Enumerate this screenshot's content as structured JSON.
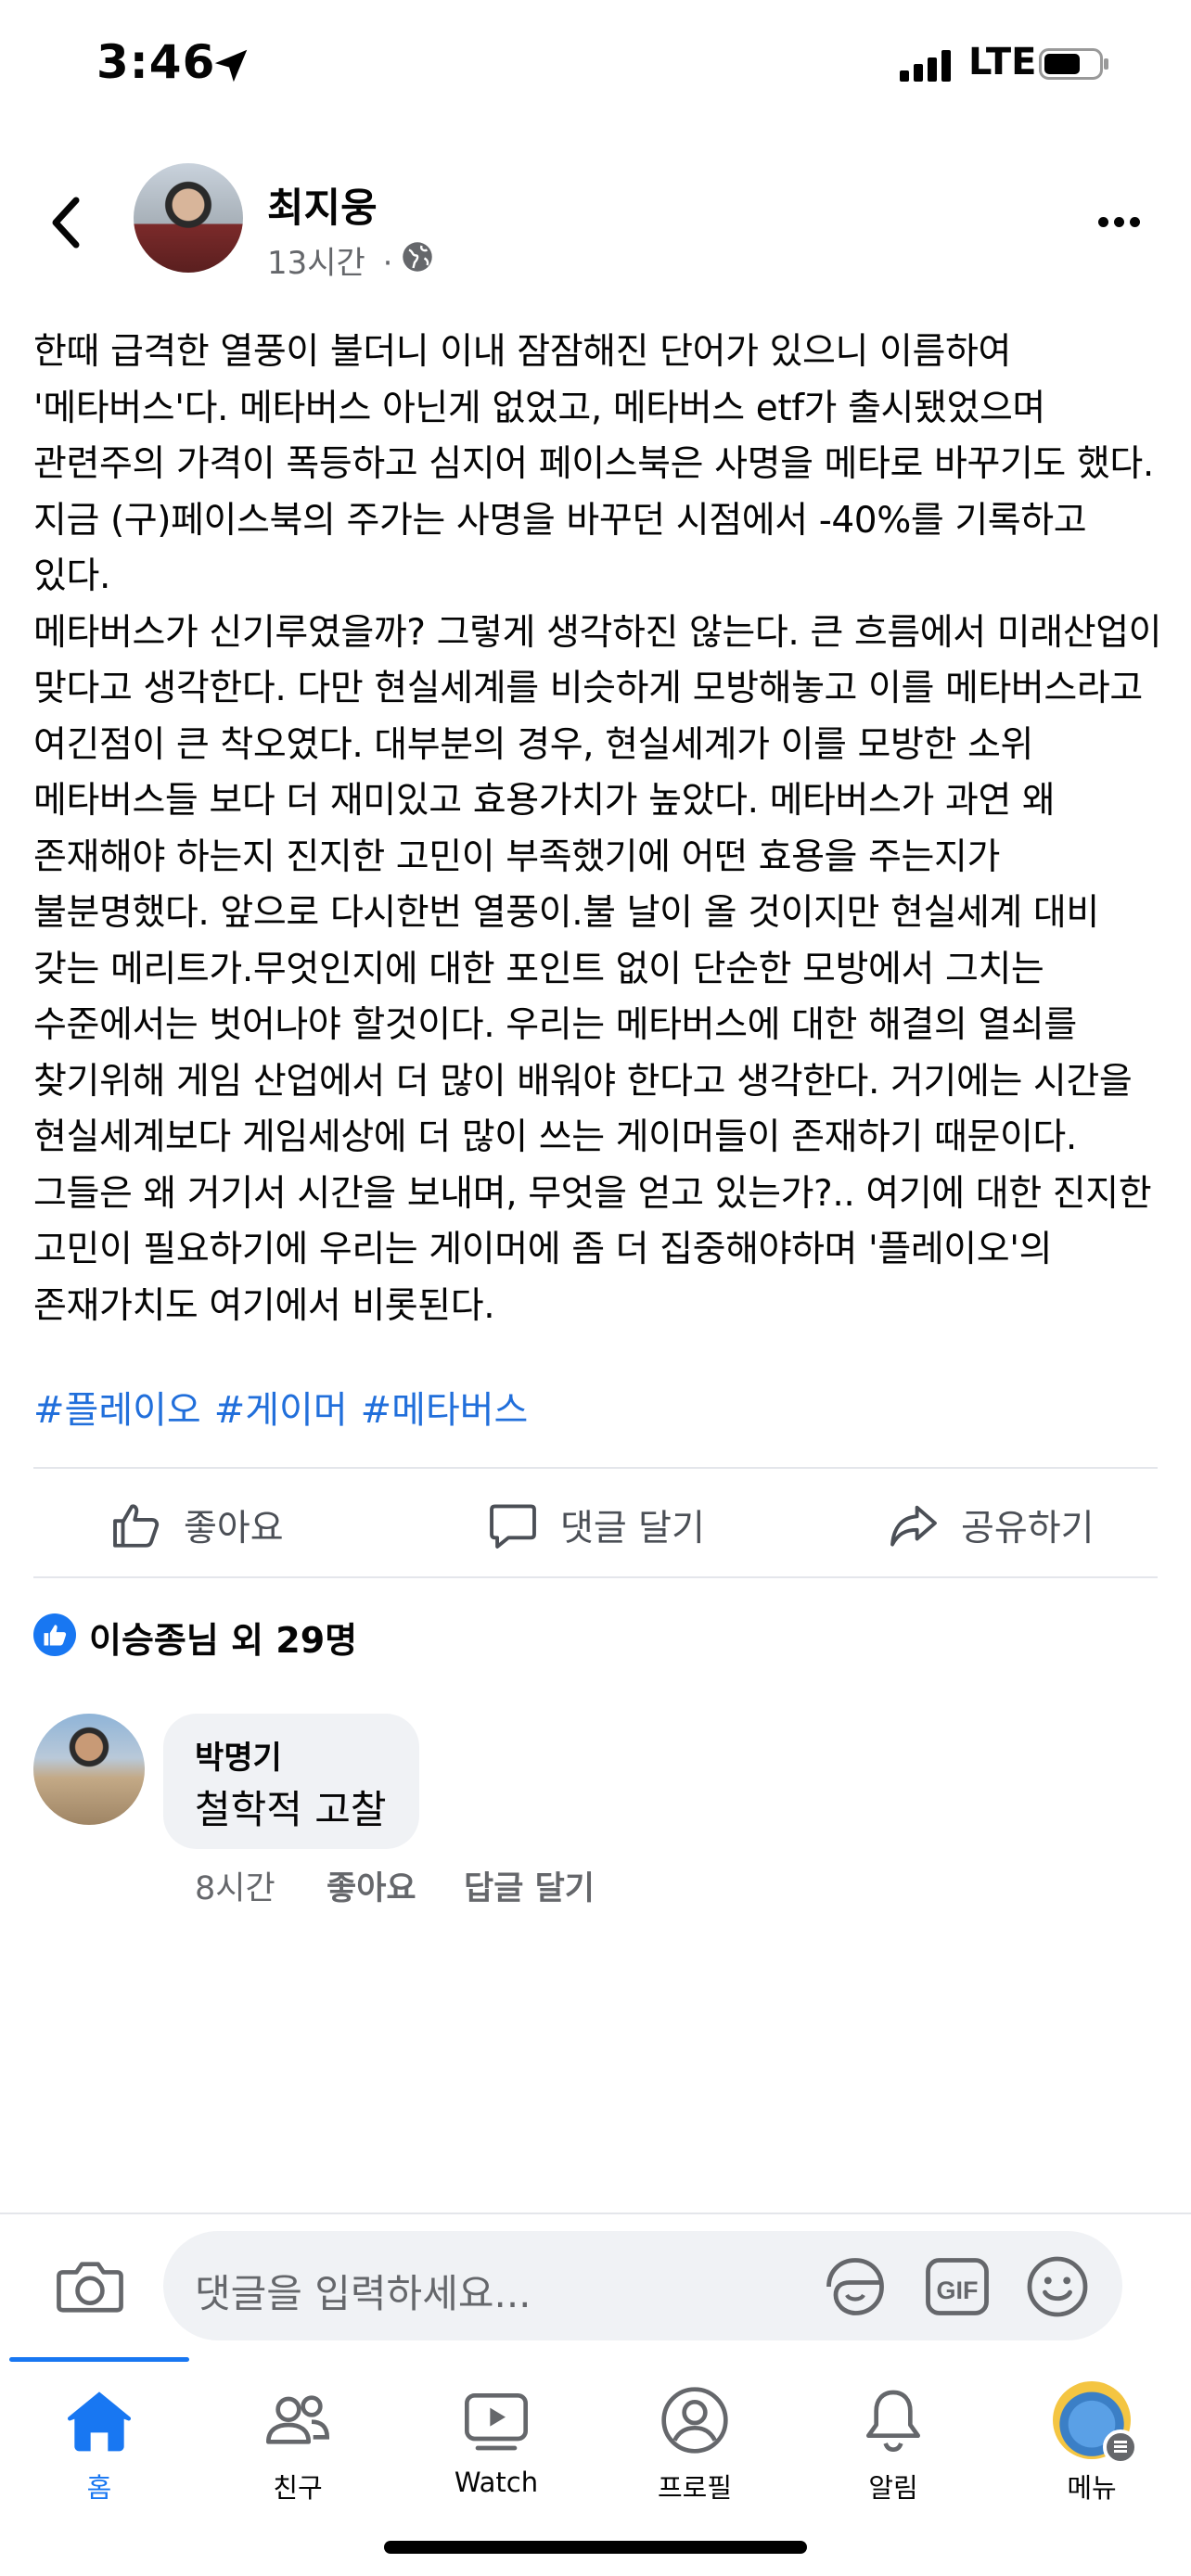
{
  "status_bar": {
    "time": "3:46",
    "network": "LTE"
  },
  "post": {
    "author": "최지웅",
    "time_ago": "13시간",
    "separator": "·",
    "body": "한때 급격한 열풍이 불더니 이내 잠잠해진 단어가 있으니 이름하여 '메타버스'다. 메타버스 아닌게 없었고, 메타버스 etf가 출시됐었으며 관련주의 가격이 폭등하고 심지어 페이스북은 사명을 메타로 바꾸기도 했다. 지금 (구)페이스북의 주가는 사명을 바꾸던 시점에서 -40%를 기록하고 있다.\n메타버스가 신기루였을까? 그렇게 생각하진 않는다. 큰 흐름에서 미래산업이 맞다고 생각한다. 다만 현실세계를 비슷하게 모방해놓고 이를 메타버스라고 여긴점이 큰 착오였다. 대부분의 경우, 현실세계가 이를 모방한 소위 메타버스들 보다 더 재미있고 효용가치가 높았다. 메타버스가 과연 왜 존재해야 하는지 진지한 고민이 부족했기에 어떤 효용을 주는지가 불분명했다. 앞으로 다시한번 열풍이.불 날이 올 것이지만 현실세계 대비 갖는 메리트가.무엇인지에 대한 포인트 없이 단순한 모방에서 그치는 수준에서는 벗어나야 할것이다. 우리는 메타버스에 대한 해결의 열쇠를 찾기위해 게임 산업에서 더 많이 배워야 한다고 생각한다. 거기에는 시간을 현실세계보다 게임세상에 더 많이 쓰는 게이머들이 존재하기 때문이다. 그들은 왜 거기서 시간을 보내며, 무엇을 얻고 있는가?.. 여기에 대한 진지한 고민이 필요하기에 우리는 게이머에 좀 더 집중해야하며 '플레이오'의 존재가치도 여기에서 비롯된다.",
    "hashtags": [
      "#플레이오",
      "#게이머",
      "#메타버스"
    ]
  },
  "actions": {
    "like": "좋아요",
    "comment": "댓글 달기",
    "share": "공유하기"
  },
  "reactions": {
    "summary": "이승종님 외 29명"
  },
  "comments": [
    {
      "author": "박명기",
      "text": "철학적 고찰",
      "time_ago": "8시간",
      "like": "좋아요",
      "reply": "답글 달기"
    }
  ],
  "composer": {
    "placeholder": "댓글을 입력하세요...",
    "gif_label": "GIF"
  },
  "tabs": [
    {
      "label": "홈",
      "icon": "home-icon",
      "active": true
    },
    {
      "label": "친구",
      "icon": "friends-icon"
    },
    {
      "label": "Watch",
      "icon": "watch-icon"
    },
    {
      "label": "프로필",
      "icon": "profile-icon"
    },
    {
      "label": "알림",
      "icon": "bell-icon"
    },
    {
      "label": "메뉴",
      "icon": "menu-avatar-icon"
    }
  ],
  "colors": {
    "accent": "#1877f2",
    "hashtag": "#216fdb",
    "muted": "#65676b",
    "bubble": "#f0f2f5"
  }
}
